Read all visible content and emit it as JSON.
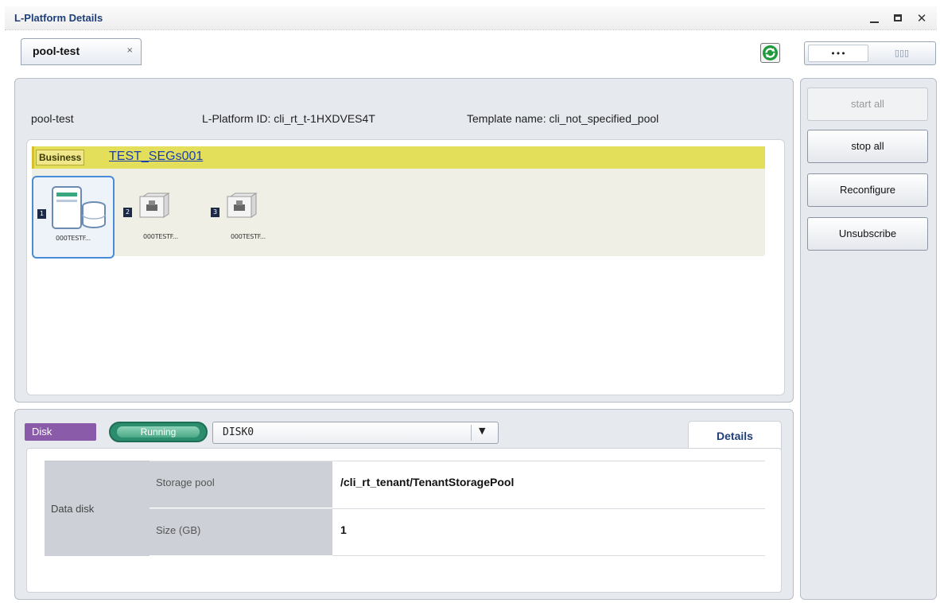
{
  "window": {
    "title": "L-Platform Details"
  },
  "tab": {
    "label": "pool-test",
    "close": "×"
  },
  "view_toggle": {
    "left": "•••",
    "right": "▯▯▯"
  },
  "platform": {
    "name": "pool-test",
    "id_text": "L-Platform ID: cli_rt_t-1HXDVES4T",
    "template_text": "Template name: cli_not_specified_pool"
  },
  "segment": {
    "type": "Business",
    "name": "TEST_SEGs001",
    "servers": [
      {
        "number": "1",
        "label": "000TESTF...",
        "selected": true
      },
      {
        "number": "2",
        "label": "000TESTF...",
        "selected": false
      },
      {
        "number": "3",
        "label": "000TESTF...",
        "selected": false
      }
    ]
  },
  "actions": {
    "start_all": "start all",
    "stop_all": "stop all",
    "reconfigure": "Reconfigure",
    "unsubscribe": "Unsubscribe"
  },
  "disk_panel": {
    "type_badge": "Disk",
    "status": "Running",
    "selected_disk": "DISK0",
    "details_tab": "Details",
    "group_label": "Data disk",
    "rows": [
      {
        "name": "Storage pool",
        "value": "/cli_rt_tenant/TenantStoragePool"
      },
      {
        "name": "Size (GB)",
        "value": "1"
      }
    ]
  },
  "colors": {
    "title_text": "#1f3f7a",
    "segment_bar": "#e3df5a",
    "disk_badge": "#8a5ba8",
    "running_status": "#2c8d6e",
    "link": "#1a3fb0"
  }
}
